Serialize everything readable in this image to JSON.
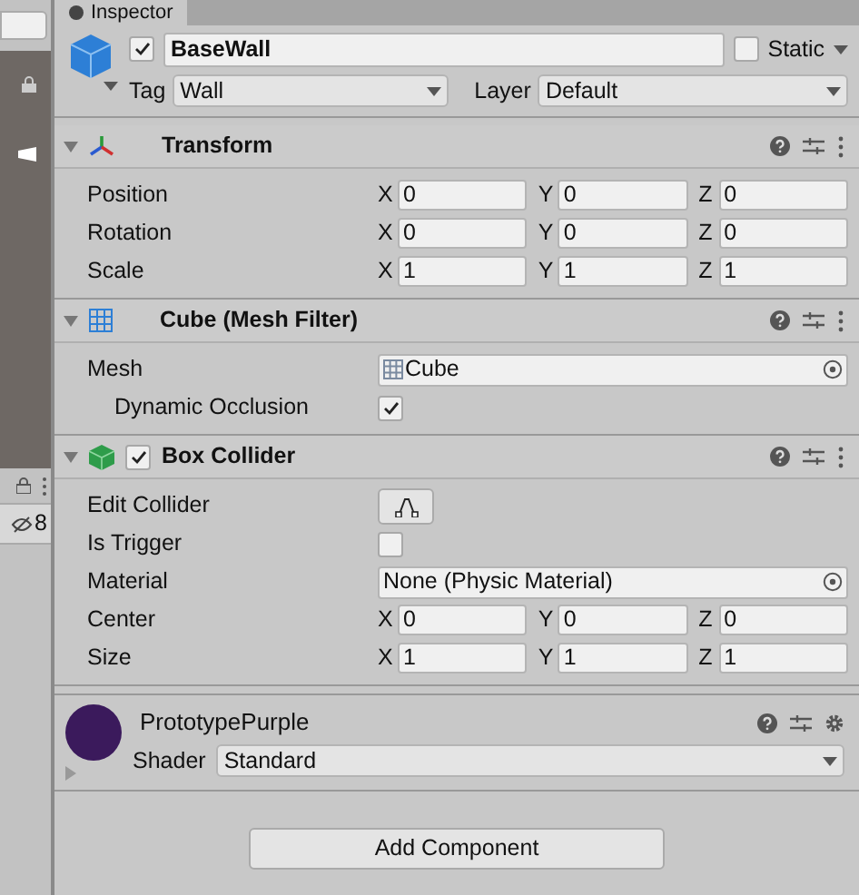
{
  "tab": {
    "label": "Inspector"
  },
  "left_panel": {
    "hidden_count": "8"
  },
  "object": {
    "active": true,
    "name": "BaseWall",
    "static": {
      "label": "Static",
      "checked": false
    },
    "tag": {
      "label": "Tag",
      "value": "Wall"
    },
    "layer": {
      "label": "Layer",
      "value": "Default"
    }
  },
  "components": [
    {
      "kind": "transform",
      "title": "Transform",
      "rows": [
        {
          "kind": "vector",
          "label": "Position",
          "fields": [
            {
              "axis": "X",
              "value": "0"
            },
            {
              "axis": "Y",
              "value": "0"
            },
            {
              "axis": "Z",
              "value": "0"
            }
          ]
        },
        {
          "kind": "vector",
          "label": "Rotation",
          "fields": [
            {
              "axis": "X",
              "value": "0"
            },
            {
              "axis": "Y",
              "value": "0"
            },
            {
              "axis": "Z",
              "value": "0"
            }
          ]
        },
        {
          "kind": "vector",
          "label": "Scale",
          "fields": [
            {
              "axis": "X",
              "value": "1"
            },
            {
              "axis": "Y",
              "value": "1"
            },
            {
              "axis": "Z",
              "value": "1"
            }
          ]
        }
      ]
    },
    {
      "kind": "mesh_filter",
      "title": "Cube (Mesh Filter)",
      "rows": [
        {
          "kind": "object",
          "label": "Mesh",
          "value": "Cube"
        },
        {
          "kind": "checkbox",
          "label": "Dynamic Occlusion",
          "checked": true
        }
      ]
    },
    {
      "kind": "box_collider",
      "title": "Box Collider",
      "enabled": true,
      "rows": [
        {
          "kind": "button",
          "label": "Edit Collider"
        },
        {
          "kind": "checkbox",
          "label": "Is Trigger",
          "checked": false
        },
        {
          "kind": "object",
          "label": "Material",
          "value": "None (Physic Material)"
        },
        {
          "kind": "vector",
          "label": "Center",
          "fields": [
            {
              "axis": "X",
              "value": "0"
            },
            {
              "axis": "Y",
              "value": "0"
            },
            {
              "axis": "Z",
              "value": "0"
            }
          ]
        },
        {
          "kind": "vector",
          "label": "Size",
          "fields": [
            {
              "axis": "X",
              "value": "1"
            },
            {
              "axis": "Y",
              "value": "1"
            },
            {
              "axis": "Z",
              "value": "1"
            }
          ]
        }
      ]
    }
  ],
  "material": {
    "name": "PrototypePurple",
    "shader_label": "Shader",
    "shader": "Standard"
  },
  "add_component": "Add Component"
}
